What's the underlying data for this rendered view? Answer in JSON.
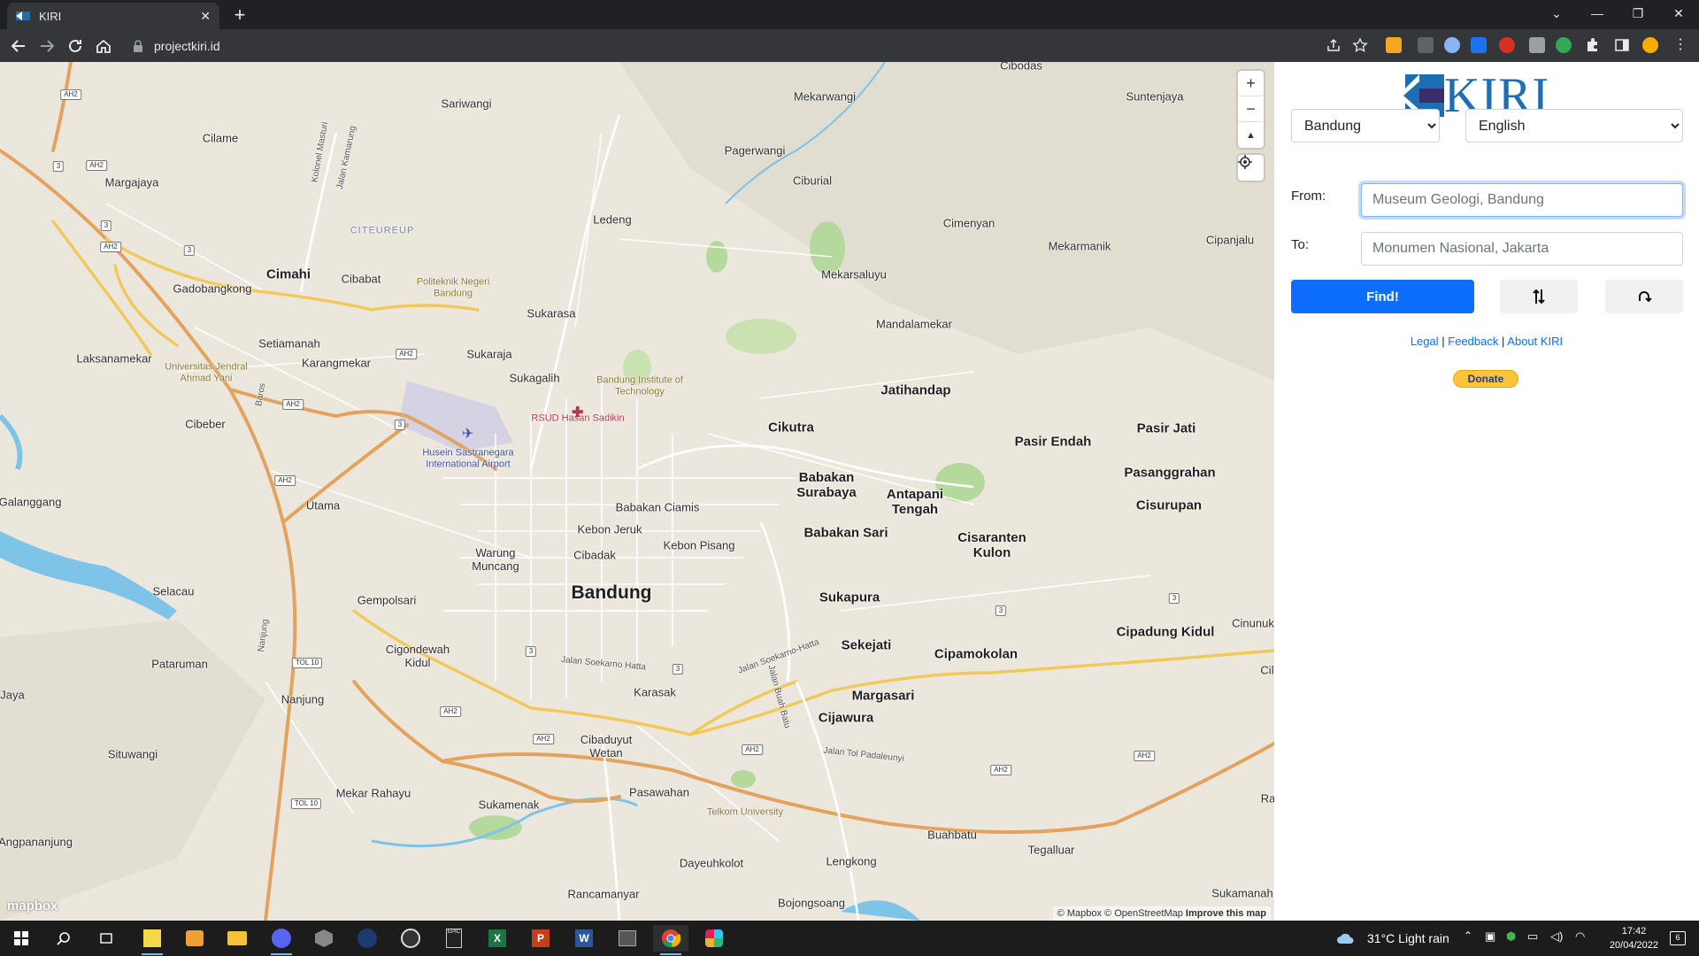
{
  "browser": {
    "tab_title": "KIRI",
    "url": "projectkiri.id"
  },
  "map": {
    "places": [
      {
        "label": "Cibodas",
        "kind": "normal"
      },
      {
        "label": "Sariwangi",
        "kind": "normal"
      },
      {
        "label": "Mekarwangi",
        "kind": "normal"
      },
      {
        "label": "Suntenjaya",
        "kind": "normal"
      },
      {
        "label": "Cilame",
        "kind": "normal"
      },
      {
        "label": "Pagerwangi",
        "kind": "normal"
      },
      {
        "label": "Margajaya",
        "kind": "normal"
      },
      {
        "label": "Ciburial",
        "kind": "normal"
      },
      {
        "label": "Ledeng",
        "kind": "normal"
      },
      {
        "label": "Cimenyan",
        "kind": "normal"
      },
      {
        "label": "CITEUREUP",
        "kind": "district"
      },
      {
        "label": "Cipanjalu",
        "kind": "normal"
      },
      {
        "label": "Mekarmanik",
        "kind": "normal"
      },
      {
        "label": "Cimahi",
        "kind": "major"
      },
      {
        "label": "Cibabat",
        "kind": "normal"
      },
      {
        "label": "Politeknik Negeri Bandung",
        "kind": "poi"
      },
      {
        "label": "Mekarsaluyu",
        "kind": "normal"
      },
      {
        "label": "Gadobangkong",
        "kind": "normal"
      },
      {
        "label": "Sukarasa",
        "kind": "normal"
      },
      {
        "label": "Mandalamekar",
        "kind": "normal"
      },
      {
        "label": "Setiamanah",
        "kind": "normal"
      },
      {
        "label": "Sukaraja",
        "kind": "normal"
      },
      {
        "label": "Laksanamekar",
        "kind": "normal"
      },
      {
        "label": "Karangmekar",
        "kind": "normal"
      },
      {
        "label": "Universitas Jendral Ahmad Yani",
        "kind": "poi"
      },
      {
        "label": "Sukagalih",
        "kind": "normal"
      },
      {
        "label": "Bandung Institute of Technology",
        "kind": "poi"
      },
      {
        "label": "Jatihandap",
        "kind": "normal"
      },
      {
        "label": "RSUD Hasan Sadikin",
        "kind": "hospital"
      },
      {
        "label": "Cibeber",
        "kind": "normal"
      },
      {
        "label": "Cikutra",
        "kind": "normal"
      },
      {
        "label": "Pasir Jati",
        "kind": "normal"
      },
      {
        "label": "Pasir Endah",
        "kind": "normal"
      },
      {
        "label": "Husein Sastranegara International Airport",
        "kind": "airport"
      },
      {
        "label": "Pasanggrahan",
        "kind": "normal"
      },
      {
        "label": "Babakan Surabaya",
        "kind": "normal"
      },
      {
        "label": "Antapani Tengah",
        "kind": "normal"
      },
      {
        "label": "Galanggang",
        "kind": "normal"
      },
      {
        "label": "Utama",
        "kind": "normal"
      },
      {
        "label": "Babakan Ciamis",
        "kind": "normal"
      },
      {
        "label": "Cisurupan",
        "kind": "normal"
      },
      {
        "label": "Kebon Jeruk",
        "kind": "normal"
      },
      {
        "label": "Babakan Sari",
        "kind": "normal"
      },
      {
        "label": "Cisaranten Kulon",
        "kind": "normal"
      },
      {
        "label": "Warung Muncang",
        "kind": "normal"
      },
      {
        "label": "Kebon Pisang",
        "kind": "normal"
      },
      {
        "label": "Cibadak",
        "kind": "normal"
      },
      {
        "label": "Selacau",
        "kind": "normal"
      },
      {
        "label": "Bandung",
        "kind": "city"
      },
      {
        "label": "Sukapura",
        "kind": "normal"
      },
      {
        "label": "Gempolsari",
        "kind": "normal"
      },
      {
        "label": "Cinunuk",
        "kind": "normal"
      },
      {
        "label": "Cipadung Kidul",
        "kind": "normal"
      },
      {
        "label": "Cigondewah Kidul",
        "kind": "normal"
      },
      {
        "label": "Sekejati",
        "kind": "normal"
      },
      {
        "label": "Cipamokolan",
        "kind": "normal"
      },
      {
        "label": "Pataruman",
        "kind": "normal"
      },
      {
        "label": "Cil",
        "kind": "normal"
      },
      {
        "label": "Karasak",
        "kind": "normal"
      },
      {
        "label": "Margasari",
        "kind": "normal"
      },
      {
        "label": "Jaya",
        "kind": "normal"
      },
      {
        "label": "Nanjung",
        "kind": "normal"
      },
      {
        "label": "Cijawura",
        "kind": "normal"
      },
      {
        "label": "Cibaduyut Wetan",
        "kind": "normal"
      },
      {
        "label": "Situwangi",
        "kind": "normal"
      },
      {
        "label": "Mekar Rahayu",
        "kind": "normal"
      },
      {
        "label": "Pasawahan",
        "kind": "normal"
      },
      {
        "label": "Ra",
        "kind": "normal"
      },
      {
        "label": "Sukamenak",
        "kind": "normal"
      },
      {
        "label": "Telkom University",
        "kind": "poi"
      },
      {
        "label": "Buahbatu",
        "kind": "normal"
      },
      {
        "label": "Angpananjung",
        "kind": "normal"
      },
      {
        "label": "Tegalluar",
        "kind": "normal"
      },
      {
        "label": "Dayeuhkolot",
        "kind": "normal"
      },
      {
        "label": "Lengkong",
        "kind": "normal"
      },
      {
        "label": "Rancamanyar",
        "kind": "normal"
      },
      {
        "label": "Bojongsoang",
        "kind": "normal"
      },
      {
        "label": "Sukamanah",
        "kind": "normal"
      },
      {
        "label": "Kolonel Masturi",
        "kind": "road"
      },
      {
        "label": "Jalan Kamarung",
        "kind": "road"
      },
      {
        "label": "Baros",
        "kind": "road"
      },
      {
        "label": "Nanjung",
        "kind": "road"
      },
      {
        "label": "Jalan Soekarno Hatta",
        "kind": "road"
      },
      {
        "label": "Jalan Soekarno-Hatta",
        "kind": "road"
      },
      {
        "label": "Jalan Buah Batu",
        "kind": "road"
      },
      {
        "label": "Jalan Tol Padaleunyi",
        "kind": "road"
      }
    ],
    "shields": [
      "AH2",
      "3",
      "AH2",
      "3",
      "AH2",
      "3",
      "AH2",
      "AH2",
      "3",
      "AH2",
      "TOL 10",
      "3",
      "3",
      "3",
      "AH2",
      "AH2",
      "AH2",
      "AH2",
      "AH2",
      "TOL 10",
      "3"
    ],
    "controls": {
      "zoom_in": "+",
      "zoom_out": "−",
      "compass": "▲"
    },
    "attribution": {
      "mapbox": "© Mapbox",
      "osm": "© OpenStreetMap",
      "improve": "Improve this map"
    },
    "logo": "mapbox"
  },
  "panel": {
    "logo_text": "KIRI",
    "city_select": {
      "value": "Bandung",
      "options": [
        "Bandung"
      ]
    },
    "language_select": {
      "value": "English",
      "options": [
        "English"
      ]
    },
    "from_label": "From:",
    "from_placeholder": "Museum Geologi, Bandung",
    "to_label": "To:",
    "to_placeholder": "Monumen Nasional, Jakarta",
    "find_label": "Find!",
    "links": {
      "legal": "Legal",
      "feedback": "Feedback",
      "about": "About KIRI",
      "sep": "|"
    },
    "donate_label": "Donate"
  },
  "taskbar": {
    "weather": "31°C  Light rain",
    "time": "17:42",
    "date": "20/04/2022",
    "notifications": "6"
  },
  "colors": {
    "accent": "#0d6efd",
    "kiri_blue": "#1e6eb4",
    "kiri_purple": "#3b2c6b",
    "map_bg": "#ebe7dd",
    "road_major": "#e3a35e",
    "road_yellow": "#f1c95a",
    "water": "#7ec3e8",
    "park": "#b5d99c"
  }
}
